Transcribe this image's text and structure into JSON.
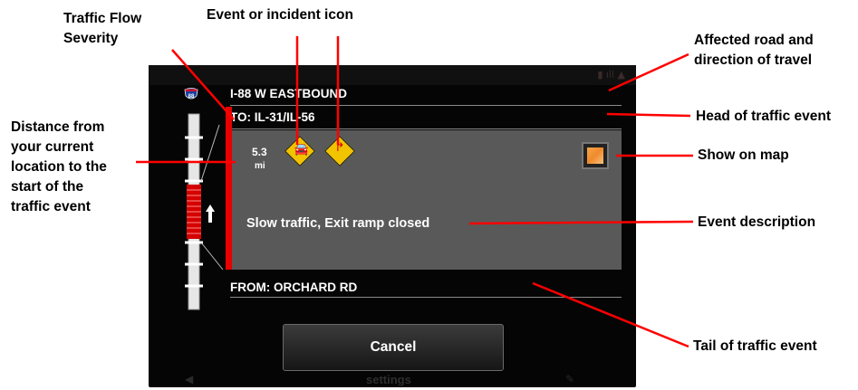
{
  "callouts": {
    "traffic_flow_severity": "Traffic Flow\nSeverity",
    "event_icon": "Event or incident icon",
    "affected_road": "Affected road and\ndirection of travel",
    "head_event": "Head of traffic event",
    "show_on_map": "Show on map",
    "distance": "Distance from\nyour current\nlocation to the\nstart of the\ntraffic event",
    "event_description": "Event description",
    "tail_event": "Tail of traffic event"
  },
  "screen": {
    "road": "I-88 W EASTBOUND",
    "to": "TO: IL-31/IL-56",
    "distance_value": "5.3",
    "distance_unit": "mi",
    "description": "Slow traffic, Exit ramp closed",
    "from": "FROM: ORCHARD RD",
    "cancel_label": "Cancel",
    "settings_label": "settings",
    "shield_label": "88"
  },
  "icons": {
    "incident_1": "slow-traffic-icon",
    "incident_2": "exit-ramp-closed-icon",
    "map": "show-on-map-icon",
    "direction": "up-arrow-icon"
  },
  "colors": {
    "severity_red": "#e80000",
    "panel_gray": "#595959",
    "incident_yellow": "#f2c400",
    "callout_line": "#ff0000"
  }
}
